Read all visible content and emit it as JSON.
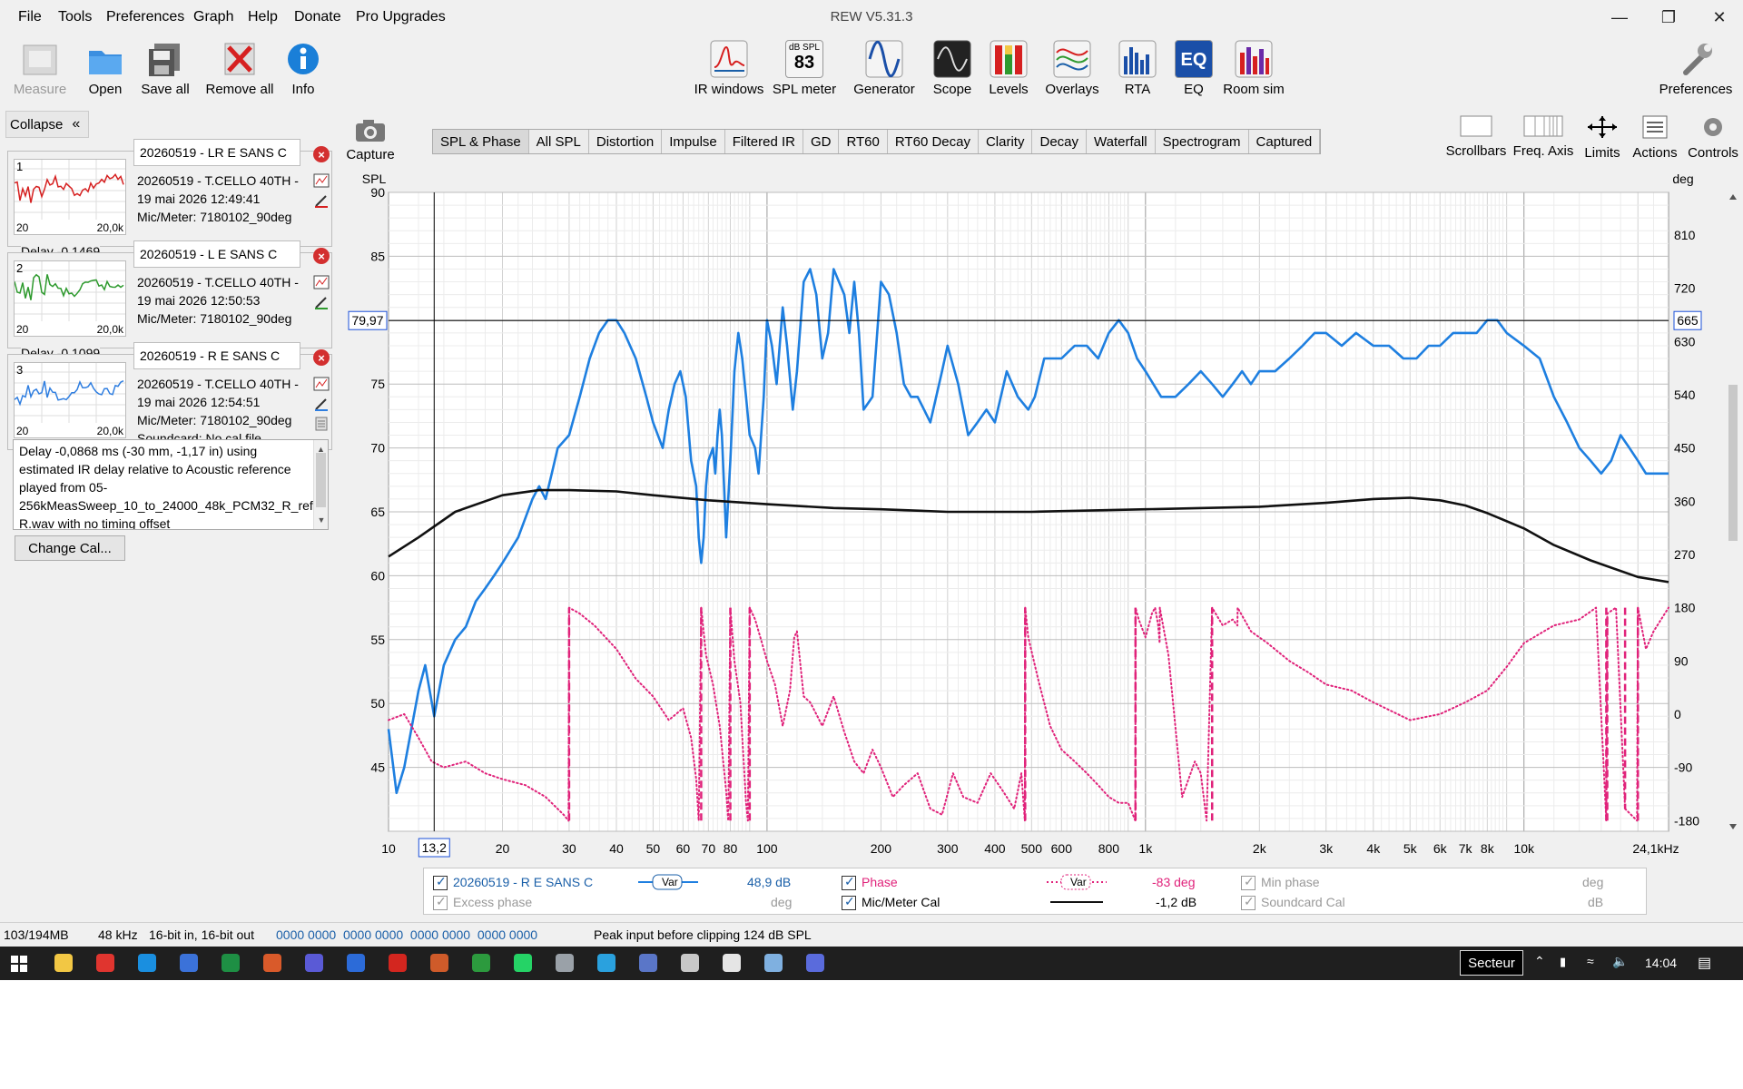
{
  "menu": [
    "File",
    "Tools",
    "Preferences",
    "Graph",
    "Help",
    "Donate",
    "Pro Upgrades"
  ],
  "app_title": "REW V5.31.3",
  "toolbar_left": [
    {
      "label": "Measure",
      "icon": "measure-icon",
      "enabled": false
    },
    {
      "label": "Open",
      "icon": "folder-open-icon",
      "enabled": true
    },
    {
      "label": "Save all",
      "icon": "save-all-icon",
      "enabled": true
    },
    {
      "label": "Remove all",
      "icon": "remove-all-icon",
      "enabled": true
    },
    {
      "label": "Info",
      "icon": "info-icon",
      "enabled": true
    }
  ],
  "toolbar_center": [
    {
      "label": "IR windows",
      "icon": "ir-windows-icon"
    },
    {
      "label": "SPL meter",
      "icon": "spl-meter-icon",
      "top": "dB SPL",
      "value": "83"
    },
    {
      "label": "Generator",
      "icon": "generator-icon"
    },
    {
      "label": "Scope",
      "icon": "scope-icon"
    },
    {
      "label": "Levels",
      "icon": "levels-icon"
    },
    {
      "label": "Overlays",
      "icon": "overlays-icon"
    },
    {
      "label": "RTA",
      "icon": "rta-icon"
    },
    {
      "label": "EQ",
      "icon": "eq-icon"
    },
    {
      "label": "Room sim",
      "icon": "room-sim-icon"
    }
  ],
  "toolbar_right": {
    "label": "Preferences",
    "icon": "wrench-icon"
  },
  "collapse_label": "Collapse",
  "measurements": [
    {
      "index": "1",
      "name": "20260519 - LR E SANS C",
      "line1": "20260519 - T.CELLO 40TH -",
      "line2": "19 mai 2026 12:49:41",
      "line3": "Mic/Meter: 7180102_90deg",
      "delay": "Delay -0,1469",
      "thumb_color": "#d62020",
      "ax_left": "20",
      "ax_right": "20,0k"
    },
    {
      "index": "2",
      "name": "20260519 - L E SANS C",
      "line1": "20260519 - T.CELLO 40TH -",
      "line2": "19 mai 2026 12:50:53",
      "line3": "Mic/Meter: 7180102_90deg",
      "delay": "Delay -0,1099",
      "thumb_color": "#2e9a2e",
      "ax_left": "20",
      "ax_right": "20,0k"
    },
    {
      "index": "3",
      "name": "20260519 - R E SANS C",
      "line1": "20260519 - T.CELLO 40TH -",
      "line2": "19 mai 2026 12:54:51",
      "line3": "Mic/Meter: 7180102_90deg",
      "line4": "Soundcard: No cal file",
      "thumb_color": "#2f7ee0",
      "ax_left": "20",
      "ax_right": "20,0k"
    }
  ],
  "info_text": "Delay -0,0868 ms (-30 mm, -1,17 in) using estimated IR delay relative to Acoustic reference played from 05-256kMeasSweep_10_to_24000_48k_PCM32_R_ref R.wav with no timing offset",
  "change_cal_label": "Change Cal...",
  "capture_label": "Capture",
  "tabs": [
    "SPL & Phase",
    "All SPL",
    "Distortion",
    "Impulse",
    "Filtered IR",
    "GD",
    "RT60",
    "RT60 Decay",
    "Clarity",
    "Decay",
    "Waterfall",
    "Spectrogram",
    "Captured"
  ],
  "active_tab": "SPL & Phase",
  "right_tools": [
    {
      "label": "Scrollbars",
      "icon": "scrollbars-icon"
    },
    {
      "label": "Freq. Axis",
      "icon": "freq-axis-icon"
    },
    {
      "label": "Limits",
      "icon": "limits-icon"
    },
    {
      "label": "Actions",
      "icon": "actions-icon"
    },
    {
      "label": "Controls",
      "icon": "controls-icon"
    }
  ],
  "chart_data": {
    "type": "line",
    "ylabel": "SPL",
    "y2label": "deg",
    "xlim": [
      10,
      24100
    ],
    "x_scale": "log",
    "ylim": [
      40,
      90
    ],
    "y2lim": [
      -198,
      882
    ],
    "x_ticks": [
      "10",
      "20",
      "30",
      "40",
      "50",
      "60",
      "70",
      "80",
      "100",
      "200",
      "300",
      "400",
      "500",
      "600",
      "800",
      "1k",
      "2k",
      "3k",
      "4k",
      "5k",
      "6k",
      "7k",
      "8k",
      "10k",
      "24,1kHz"
    ],
    "x_tick_values": [
      10,
      20,
      30,
      40,
      50,
      60,
      70,
      80,
      100,
      200,
      300,
      400,
      500,
      600,
      800,
      1000,
      2000,
      3000,
      4000,
      5000,
      6000,
      7000,
      8000,
      10000,
      24100
    ],
    "y_ticks": [
      45,
      50,
      55,
      60,
      65,
      70,
      75,
      80,
      85,
      90
    ],
    "y2_ticks": [
      -180,
      -90,
      0,
      90,
      180,
      270,
      360,
      450,
      540,
      630,
      720,
      810
    ],
    "cursor": {
      "x": 13.2,
      "x_label": "13,2",
      "y_label": "79,97",
      "y2_label": "665"
    },
    "grid": true,
    "series": [
      {
        "name": "20260519 - R E SANS C",
        "axis": "left",
        "color": "#1e7fe0",
        "style": "solid",
        "x": [
          10,
          10.5,
          11,
          12,
          12.5,
          13.2,
          14,
          15,
          16,
          17,
          18,
          19,
          20,
          22,
          24,
          25,
          26,
          27,
          28,
          30,
          32,
          34,
          36,
          38,
          40,
          42,
          45,
          48,
          50,
          53,
          55,
          57,
          59,
          61,
          63,
          65,
          66,
          67,
          68,
          69,
          70,
          72,
          73,
          74,
          75,
          76,
          77,
          78,
          80,
          82,
          84,
          86,
          88,
          90,
          93,
          95,
          98,
          100,
          103,
          106,
          110,
          113,
          117,
          120,
          125,
          130,
          135,
          140,
          145,
          150,
          160,
          165,
          170,
          175,
          180,
          190,
          200,
          210,
          220,
          230,
          240,
          250,
          260,
          270,
          290,
          300,
          320,
          340,
          360,
          380,
          400,
          430,
          460,
          490,
          510,
          540,
          570,
          600,
          650,
          700,
          750,
          800,
          850,
          900,
          950,
          1000,
          1100,
          1200,
          1300,
          1400,
          1500,
          1600,
          1700,
          1800,
          1900,
          2000,
          2200,
          2400,
          2600,
          2800,
          3000,
          3300,
          3600,
          4000,
          4400,
          4800,
          5200,
          5600,
          6000,
          6500,
          7000,
          7500,
          8000,
          8500,
          9000,
          10000,
          11000,
          12000,
          13000,
          14000,
          15000,
          16000,
          17000,
          18000,
          19000,
          20000,
          21000,
          22000,
          24100
        ],
        "y": [
          48,
          43,
          45,
          51,
          53,
          49,
          53,
          55,
          56,
          58,
          59,
          60,
          61,
          63,
          66,
          67,
          66,
          68,
          70,
          71,
          74,
          77,
          79,
          80,
          80,
          79,
          77,
          74,
          72,
          70,
          73,
          75,
          76,
          74,
          69,
          67,
          63,
          61,
          63,
          67,
          69,
          70,
          68,
          71,
          73,
          71,
          67,
          63,
          69,
          76,
          79,
          77,
          74,
          71,
          70,
          68,
          74,
          80,
          78,
          75,
          81,
          78,
          73,
          76,
          83,
          84,
          82,
          77,
          79,
          84,
          82,
          79,
          83,
          79,
          73,
          74,
          83,
          82,
          79,
          75,
          74,
          74,
          73,
          72,
          76,
          78,
          75,
          71,
          72,
          73,
          72,
          76,
          74,
          73,
          74,
          77,
          77,
          77,
          78,
          78,
          77,
          79,
          80,
          79,
          77,
          76,
          74,
          74,
          75,
          76,
          75,
          74,
          75,
          76,
          75,
          76,
          76,
          77,
          78,
          79,
          79,
          78,
          79,
          78,
          78,
          77,
          77,
          78,
          78,
          79,
          79,
          79,
          80,
          80,
          79,
          78,
          77,
          74,
          72,
          70,
          69,
          68,
          69,
          71,
          70,
          69,
          68,
          68,
          68
        ]
      },
      {
        "name": "Mic/Meter Cal",
        "axis": "left",
        "color": "#111111",
        "style": "solid",
        "x": [
          10,
          12,
          15,
          20,
          25,
          30,
          40,
          50,
          70,
          100,
          150,
          200,
          300,
          500,
          1000,
          2000,
          3000,
          4000,
          5000,
          6000,
          7000,
          8000,
          10000,
          12000,
          15000,
          20000,
          24100
        ],
        "y": [
          61.5,
          63,
          65,
          66.3,
          66.7,
          66.7,
          66.6,
          66.3,
          65.9,
          65.6,
          65.3,
          65.2,
          65,
          65,
          65.2,
          65.4,
          65.7,
          66,
          66.1,
          65.9,
          65.5,
          64.9,
          63.7,
          62.4,
          61.2,
          59.9,
          59.5
        ]
      },
      {
        "name": "Phase",
        "axis": "right",
        "color": "#e0227a",
        "style": "dotted",
        "x": [
          10,
          11,
          12,
          13,
          14,
          16,
          18,
          20,
          23,
          26,
          29,
          29.9,
          30,
          32,
          35,
          40,
          45,
          50,
          55,
          60,
          63,
          65,
          66,
          67,
          69,
          72,
          75,
          78,
          79,
          80,
          82,
          85,
          88,
          89,
          90,
          93,
          97,
          100,
          105,
          110,
          115,
          118,
          120,
          125,
          130,
          135,
          140,
          150,
          160,
          170,
          180,
          190,
          200,
          215,
          230,
          250,
          270,
          290,
          310,
          330,
          360,
          390,
          420,
          450,
          470,
          480,
          481,
          490,
          520,
          560,
          600,
          650,
          700,
          750,
          800,
          850,
          900,
          940,
          941,
          960,
          1000,
          1020,
          1040,
          1060,
          1080,
          1090,
          1091,
          1150,
          1250,
          1350,
          1400,
          1450,
          1500,
          1600,
          1700,
          1750,
          1751,
          1900,
          2100,
          2400,
          2700,
          3000,
          3500,
          4000,
          5000,
          6000,
          7000,
          8000,
          9000,
          10000,
          12000,
          14000,
          15500,
          16500,
          16600,
          17500,
          18500,
          19900,
          20000,
          21000,
          22000,
          24100
        ],
        "y": [
          -10,
          0,
          -40,
          -80,
          -90,
          -80,
          -100,
          -110,
          -120,
          -140,
          -170,
          -180,
          180,
          170,
          150,
          110,
          60,
          30,
          -10,
          10,
          -40,
          -110,
          -180,
          180,
          100,
          50,
          -20,
          -130,
          -180,
          180,
          90,
          20,
          -150,
          -180,
          180,
          160,
          120,
          90,
          50,
          -20,
          40,
          130,
          140,
          30,
          20,
          0,
          -20,
          30,
          -30,
          -80,
          -100,
          -60,
          -90,
          -140,
          -120,
          -100,
          -160,
          -170,
          -100,
          -140,
          -150,
          -100,
          -130,
          -160,
          -100,
          -180,
          180,
          130,
          60,
          -20,
          -60,
          -80,
          -100,
          -120,
          -140,
          -150,
          -150,
          -180,
          180,
          160,
          130,
          150,
          170,
          180,
          150,
          120,
          180,
          100,
          -140,
          -80,
          -100,
          -180,
          180,
          150,
          160,
          150,
          180,
          140,
          120,
          90,
          70,
          50,
          40,
          20,
          -10,
          0,
          20,
          40,
          80,
          120,
          150,
          160,
          180,
          -180,
          170,
          180,
          -160,
          -180,
          180,
          110,
          140,
          180
        ]
      }
    ]
  },
  "legend": {
    "row1": [
      {
        "label": "20260519 - R E SANS C",
        "checked": true,
        "var": "Var",
        "value": "48,9 dB"
      },
      {
        "label": "Phase",
        "checked": true,
        "var": "Var",
        "value": "-83 deg"
      },
      {
        "label": "Min phase",
        "checked": true,
        "dim": true,
        "value": "deg"
      }
    ],
    "row2": [
      {
        "label": "Excess phase",
        "checked": true,
        "dim": true,
        "value": "deg"
      },
      {
        "label": "Mic/Meter Cal",
        "checked": true,
        "value": "-1,2 dB"
      },
      {
        "label": "Soundcard Cal",
        "checked": true,
        "dim": true,
        "value": "dB"
      }
    ]
  },
  "status": {
    "memory": "103/194MB",
    "rate": "48 kHz",
    "bits": "16-bit in, 16-bit out",
    "hex": "0000 0000  0000 0000  0000 0000  0000 0000",
    "clip": "Peak input before clipping 124 dB SPL"
  },
  "taskbar": {
    "secteur": "Secteur",
    "time": "14:04",
    "apps": [
      "#f2c744",
      "#e0352f",
      "#1a8fe0",
      "#3b72d9",
      "#1e8f44",
      "#d95a2a",
      "#5a5ad6",
      "#2c6bd8",
      "#d3261f",
      "#cf5b2a",
      "#2c9a3e",
      "#25d366",
      "#9aa1a8",
      "#2aa1de",
      "#5a76c8",
      "#c8c8c8",
      "#e5e5e5",
      "#7fb0e0",
      "#5a6bdc"
    ]
  }
}
